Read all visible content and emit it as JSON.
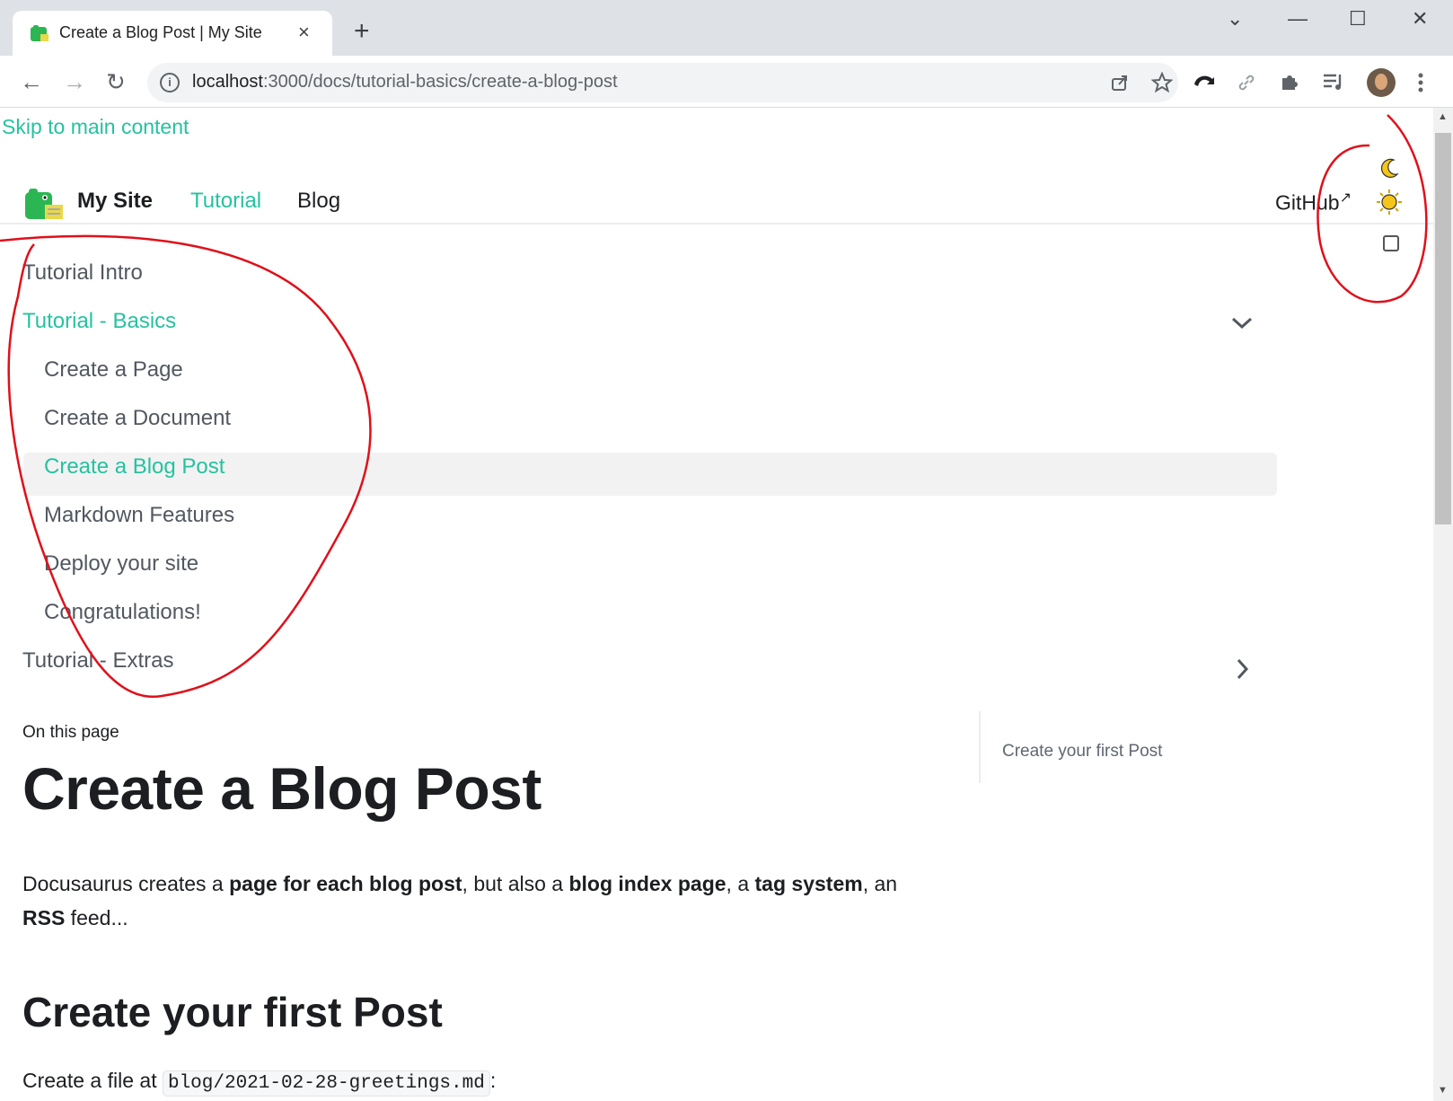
{
  "browser": {
    "tab_title": "Create a Blog Post | My Site",
    "tab_close": "×",
    "new_tab": "+",
    "url_host": "localhost",
    "url_path": ":3000/docs/tutorial-basics/create-a-blog-post",
    "window_controls": {
      "minimize": "—",
      "maximize": "☐",
      "close": "✕",
      "tab_search": "⌄"
    },
    "nav": {
      "back": "←",
      "forward": "→",
      "reload": "↻"
    },
    "toolbar_icons": [
      "share-icon",
      "star-icon",
      "extension-icon",
      "link-icon",
      "puzzle-icon",
      "media-icon",
      "avatar",
      "menu-icon"
    ]
  },
  "page": {
    "skip_link": "Skip to main content",
    "navbar": {
      "brand": "My Site",
      "links": [
        "Tutorial",
        "Blog"
      ],
      "github": "GitHub",
      "github_ext": "↗"
    },
    "sidebar": {
      "items": [
        {
          "label": "Tutorial Intro"
        },
        {
          "label": "Tutorial - Basics",
          "expanded": true,
          "active": true,
          "caret": "⌄"
        },
        {
          "label": "Create a Page"
        },
        {
          "label": "Create a Document"
        },
        {
          "label": "Create a Blog Post",
          "active": true
        },
        {
          "label": "Markdown Features"
        },
        {
          "label": "Deploy your site"
        },
        {
          "label": "Congratulations!"
        },
        {
          "label": "Tutorial - Extras",
          "expanded": false,
          "caret": "›"
        }
      ]
    },
    "on_this_page": "On this page",
    "toc": [
      "Create your first Post"
    ],
    "title": "Create a Blog Post",
    "intro": {
      "t1": "Docusaurus creates a ",
      "b1": "page for each blog post",
      "t2": ", but also a ",
      "b2": "blog index page",
      "t3": ", a ",
      "b3": "tag system",
      "t4": ", an ",
      "b4": "RSS",
      "t5": " feed..."
    },
    "h2": "Create your first Post",
    "p2_text": "Create a file at ",
    "p2_code": "blog/2021-02-28-greetings.md",
    "p2_tail": ":"
  },
  "colors": {
    "accent": "#25c2a0",
    "text": "#1c1e21",
    "annotation": "#e0101a"
  }
}
